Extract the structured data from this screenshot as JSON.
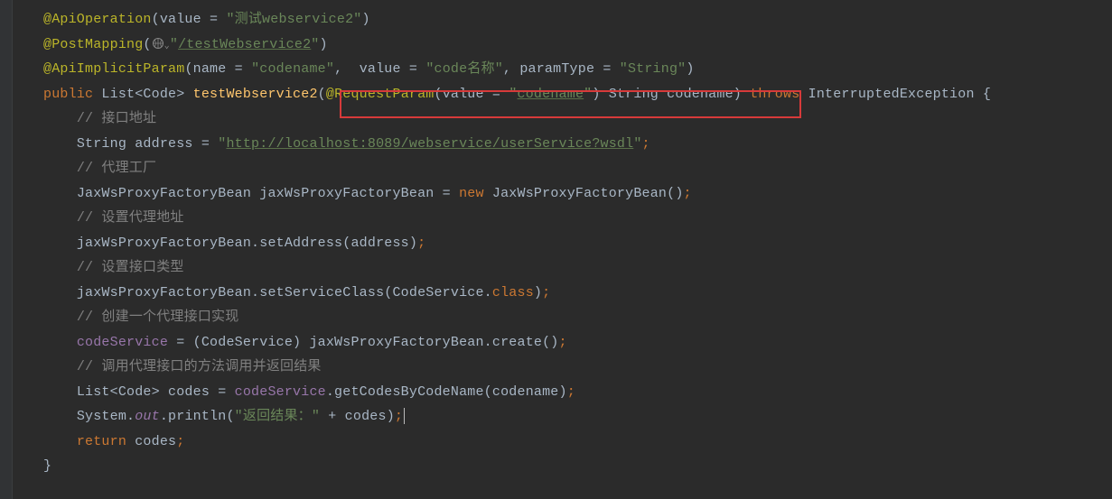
{
  "lines": {
    "l1": {
      "ann": "@ApiOperation",
      "open": "(",
      "attrVal": "value = ",
      "str": "\"测试webservice2\"",
      "close": ")"
    },
    "l2": {
      "ann": "@PostMapping",
      "open": "(",
      "strOpen": "\"",
      "url": "/testWebservice2",
      "strClose": "\"",
      "close": ")"
    },
    "l3": {
      "ann": "@ApiImplicitParam",
      "open": "(",
      "p1k": "name = ",
      "p1v": "\"codename\"",
      "sep1": ",  ",
      "p2k": "value = ",
      "p2v": "\"code名称\"",
      "sep2": ", ",
      "p3k": "paramType = ",
      "p3v": "\"String\"",
      "close": ")"
    },
    "l4": {
      "kwPublic": "public ",
      "typeList": "List<Code> ",
      "method": "testWebservice2",
      "open": "(",
      "ann": "@RequestParam",
      "open2": "(",
      "attrVal": "value = ",
      "strOpen": "\"",
      "codename": "codename",
      "strClose": "\"",
      "close2": ") ",
      "argtype": "String codename",
      "close": ") ",
      "kwThrows": "throws ",
      "exc": "InterruptedException ",
      "brace": "{"
    },
    "l5": {
      "c": "// 接口地址"
    },
    "l6": {
      "t1": "String address = ",
      "strOpen": "\"",
      "url": "http://localhost:8089/webservice/userService?wsdl",
      "strClose": "\"",
      "semi": ";"
    },
    "l7": {
      "c": "// 代理工厂"
    },
    "l8": {
      "a": "JaxWsProxyFactoryBean jaxWsProxyFactoryBean = ",
      "kwNew": "new ",
      "b": "JaxWsProxyFactoryBean()",
      "semi": ";"
    },
    "l9": {
      "c": "// 设置代理地址"
    },
    "l10": {
      "a": "jaxWsProxyFactoryBean.setAddress(address)",
      "semi": ";"
    },
    "l11": {
      "c": "// 设置接口类型"
    },
    "l12": {
      "a": "jaxWsProxyFactoryBean.setServiceClass(CodeService.",
      "kwClass": "class",
      "b": ")",
      "semi": ";"
    },
    "l13": {
      "c": "// 创建一个代理接口实现"
    },
    "l14": {
      "field": "codeService",
      "a": " = (CodeService) jaxWsProxyFactoryBean.create()",
      "semi": ";"
    },
    "l15": {
      "c": "// 调用代理接口的方法调用并返回结果"
    },
    "l16": {
      "a": "List<Code> codes = ",
      "field": "codeService",
      "b": ".getCodesByCodeName(codename)",
      "semi": ";"
    },
    "l17": {
      "a": "System.",
      "out": "out",
      "b": ".println(",
      "str": "\"返回结果：\" ",
      "c": "+ codes)",
      "semi": ";"
    },
    "l18": {
      "kwReturn": "return ",
      "a": "codes",
      "semi": ";"
    },
    "l19": {
      "brace": "}"
    }
  }
}
